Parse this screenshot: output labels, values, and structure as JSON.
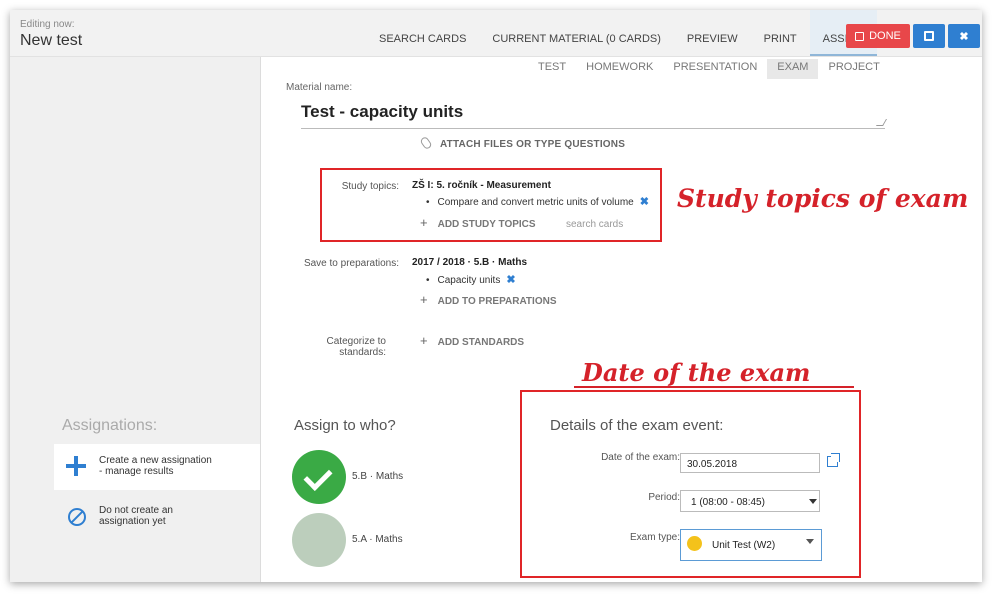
{
  "header": {
    "editing_label": "Editing now:",
    "title": "New test",
    "tabs": [
      {
        "label": "SEARCH CARDS"
      },
      {
        "label": "CURRENT MATERIAL (0 CARDS)"
      },
      {
        "label": "PREVIEW"
      },
      {
        "label": "PRINT"
      },
      {
        "label": "ASSIGN",
        "active": true
      }
    ],
    "done_label": "DONE",
    "close_label": "✖"
  },
  "material": {
    "types": [
      "TEST",
      "HOMEWORK",
      "PRESENTATION",
      "EXAM",
      "PROJECT"
    ],
    "active_type": "EXAM",
    "name_label": "Material name:",
    "name": "Test - capacity units",
    "attach_label": "ATTACH FILES OR TYPE QUESTIONS"
  },
  "study_topics": {
    "label": "Study topics:",
    "heading": "ZŠ I: 5. ročník - Measurement",
    "items": [
      "Compare and convert metric units of volume"
    ],
    "add_label": "ADD STUDY TOPICS",
    "search_label": "search cards"
  },
  "preparations": {
    "label": "Save to preparations:",
    "heading": "2017 / 2018 · 5.B · Maths",
    "items": [
      "Capacity units"
    ],
    "add_label": "ADD TO PREPARATIONS"
  },
  "standards": {
    "label_line1": "Categorize to",
    "label_line2": "standards:",
    "add_label": "ADD STANDARDS"
  },
  "annotations": {
    "topics": "Study topics of exam",
    "date": "Date of the exam"
  },
  "sidebar": {
    "heading": "Assignations:",
    "options": [
      {
        "line1": "Create a new assignation",
        "line2": "- manage results",
        "active": true
      },
      {
        "line1": "Do not create an",
        "line2": "assignation yet",
        "active": false
      }
    ]
  },
  "assign": {
    "heading": "Assign to who?",
    "recipients": [
      {
        "name": "5.B · Maths",
        "selected": true
      },
      {
        "name": "5.A · Maths",
        "selected": false
      }
    ]
  },
  "exam_event": {
    "heading": "Details of the exam event:",
    "date_label": "Date of the exam:",
    "date_value": "30.05.2018",
    "period_label": "Period:",
    "period_value": "1 (08:00 - 08:45)",
    "type_label": "Exam type:",
    "type_value": "Unit Test (W2)"
  },
  "colors": {
    "accent": "#2f7fd1",
    "done": "#e8474a",
    "annotation": "#d5222a",
    "selected": "#3aaa45"
  }
}
